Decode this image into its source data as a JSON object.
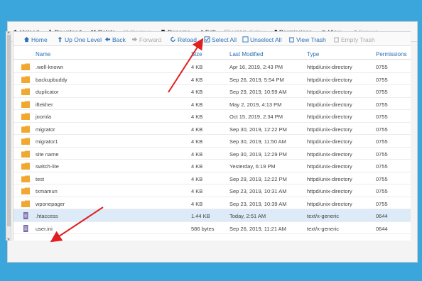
{
  "toolbar": {
    "upload": "Upload",
    "download": "Download",
    "delete": "Delete",
    "restore": "Restore",
    "rename": "Rename",
    "edit": "Edit",
    "html_editor": "HTML Editor",
    "permissions": "Permissions",
    "view": "View",
    "extract": "Extract"
  },
  "nav": {
    "home": "Home",
    "up_one_level": "Up One Level",
    "back": "Back",
    "forward": "Forward",
    "reload": "Reload",
    "select_all": "Select All",
    "unselect_all": "Unselect All",
    "view_trash": "View Trash",
    "empty_trash": "Empty Trash"
  },
  "table": {
    "headers": {
      "name": "Name",
      "size": "Size",
      "last_modified": "Last Modified",
      "type": "Type",
      "permissions": "Permissions"
    },
    "rows": [
      {
        "icon": "folder-icon",
        "name": ".well-known",
        "size": "4 KB",
        "modified": "Apr 16, 2019, 2:43 PM",
        "type": "httpd/unix-directory",
        "perm": "0755"
      },
      {
        "icon": "folder-icon",
        "name": "backupbuddy",
        "size": "4 KB",
        "modified": "Sep 26, 2019, 5:54 PM",
        "type": "httpd/unix-directory",
        "perm": "0755"
      },
      {
        "icon": "folder-icon",
        "name": "duplicator",
        "size": "4 KB",
        "modified": "Sep 29, 2019, 10:59 AM",
        "type": "httpd/unix-directory",
        "perm": "0755"
      },
      {
        "icon": "folder-icon",
        "name": "iftekher",
        "size": "4 KB",
        "modified": "May 2, 2019, 4:13 PM",
        "type": "httpd/unix-directory",
        "perm": "0755"
      },
      {
        "icon": "folder-icon",
        "name": "joomla",
        "size": "4 KB",
        "modified": "Oct 15, 2019, 2:34 PM",
        "type": "httpd/unix-directory",
        "perm": "0755"
      },
      {
        "icon": "folder-icon",
        "name": "migrator",
        "size": "4 KB",
        "modified": "Sep 30, 2019, 12:22 PM",
        "type": "httpd/unix-directory",
        "perm": "0755"
      },
      {
        "icon": "folder-icon",
        "name": "migrator1",
        "size": "4 KB",
        "modified": "Sep 30, 2019, 11:50 AM",
        "type": "httpd/unix-directory",
        "perm": "0755"
      },
      {
        "icon": "folder-icon",
        "name": "site name",
        "size": "4 KB",
        "modified": "Sep 30, 2019, 12:29 PM",
        "type": "httpd/unix-directory",
        "perm": "0755"
      },
      {
        "icon": "folder-icon",
        "name": "switch-lite",
        "size": "4 KB",
        "modified": "Yesterday, 6:19 PM",
        "type": "httpd/unix-directory",
        "perm": "0755"
      },
      {
        "icon": "folder-icon",
        "name": "test",
        "size": "4 KB",
        "modified": "Sep 29, 2019, 12:22 PM",
        "type": "httpd/unix-directory",
        "perm": "0755"
      },
      {
        "icon": "folder-icon",
        "name": "txmamun",
        "size": "4 KB",
        "modified": "Sep 23, 2019, 10:31 AM",
        "type": "httpd/unix-directory",
        "perm": "0755"
      },
      {
        "icon": "folder-icon",
        "name": "wponepager",
        "size": "4 KB",
        "modified": "Sep 23, 2019, 10:39 AM",
        "type": "httpd/unix-directory",
        "perm": "0755"
      },
      {
        "icon": "file-icon",
        "name": ".htaccess",
        "size": "1.44 KB",
        "modified": "Today, 2:51 AM",
        "type": "text/x-generic",
        "perm": "0644"
      },
      {
        "icon": "file-icon",
        "name": "user.ini",
        "size": "586 bytes",
        "modified": "Sep 26, 2019, 11:21 AM",
        "type": "text/x-generic",
        "perm": "0644"
      }
    ],
    "selected_row": ".htaccess"
  },
  "colors": {
    "background": "#3aa6dc",
    "link": "#2a6fb5",
    "folder": "#f0a830",
    "file": "#7a6aa8",
    "arrow": "#e02020",
    "selected_row": "#dcebf7"
  }
}
